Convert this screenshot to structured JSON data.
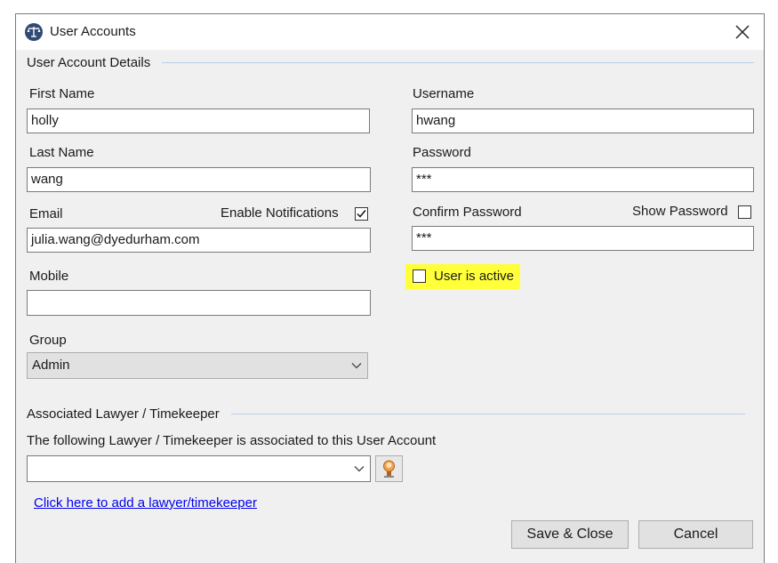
{
  "window": {
    "title": "User Accounts"
  },
  "details": {
    "section_title": "User Account Details",
    "first_name_label": "First Name",
    "first_name_value": "holly",
    "last_name_label": "Last Name",
    "last_name_value": "wang",
    "email_label": "Email",
    "email_value": "julia.wang@dyedurham.com",
    "enable_notifications_label": "Enable Notifications",
    "enable_notifications_checked": true,
    "mobile_label": "Mobile",
    "mobile_value": "",
    "group_label": "Group",
    "group_value": "Admin",
    "username_label": "Username",
    "username_value": "hwang",
    "password_label": "Password",
    "password_value": "***",
    "confirm_password_label": "Confirm Password",
    "confirm_password_value": "***",
    "show_password_label": "Show Password",
    "show_password_checked": false,
    "user_active_label": "User is active",
    "user_active_checked": false
  },
  "lawyer": {
    "section_title": "Associated Lawyer / Timekeeper",
    "description": "The following Lawyer / Timekeeper is associated to this User Account",
    "selected_value": "",
    "add_link": "Click here to add a lawyer/timekeeper"
  },
  "footer": {
    "save_label": "Save & Close",
    "cancel_label": "Cancel"
  },
  "colors": {
    "highlight": "#ffff3a",
    "link": "#0000ee",
    "section_line": "#b9d1ea"
  }
}
